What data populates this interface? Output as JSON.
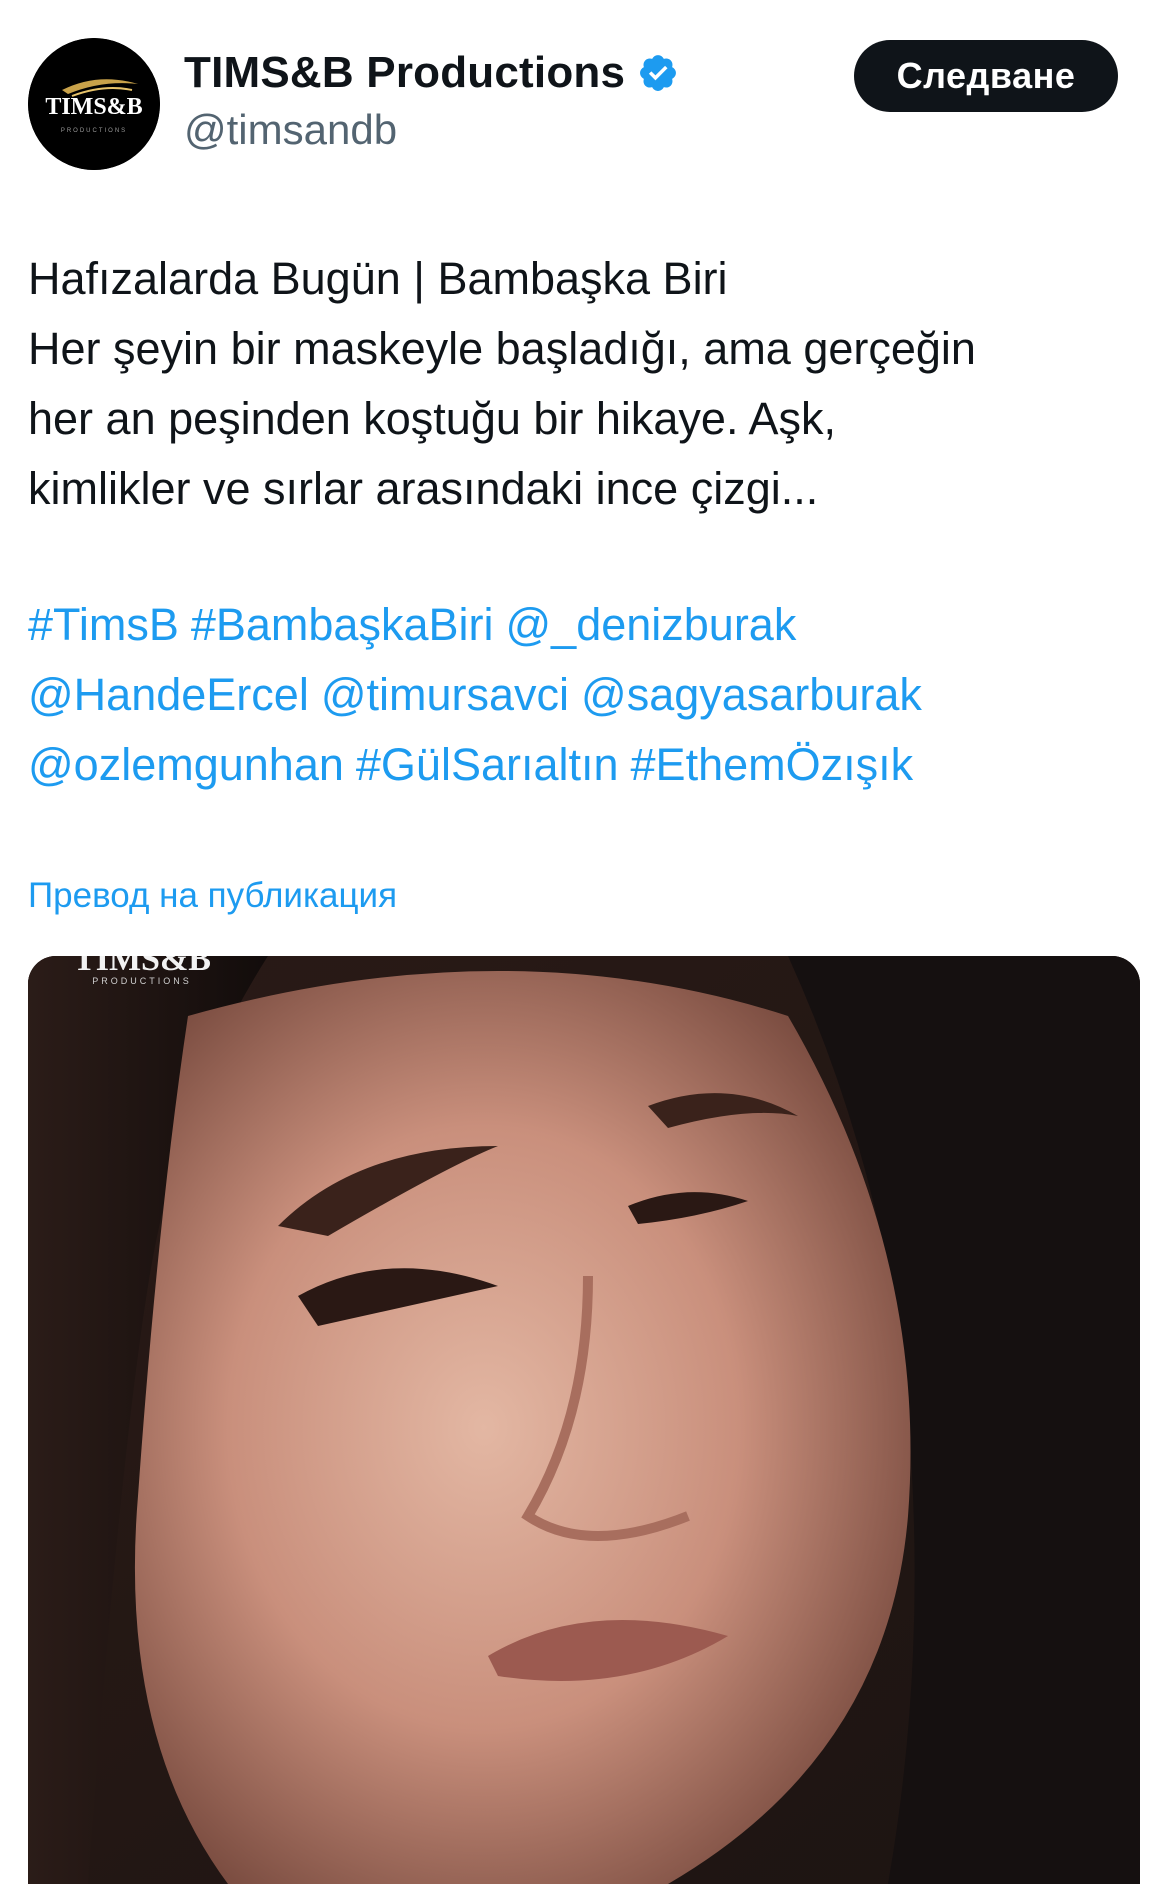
{
  "account": {
    "display_name": "TIMS&B Productions",
    "handle": "@timsandb",
    "avatar_text": "TIMS&B",
    "avatar_subtext": "PRODUCTIONS",
    "verified_icon": "verified-badge-icon",
    "verified_color": "#1d9bf0"
  },
  "actions": {
    "follow_label": "Следване"
  },
  "tweet": {
    "lines": [
      "Hafızalarda Bugün | Bambaşka Biri",
      "Her şeyin bir maskeyle başladığı, ama gerçeğin",
      "her an peşinden koştuğu bir hikaye. Aşk,",
      "kimlikler ve sırlar arasındaki ince çizgi..."
    ],
    "tag_lines": [
      [
        "#TimsB",
        "#BambaşkaBiri",
        "@_denizburak"
      ],
      [
        "@HandeErcel",
        "@timursavci",
        "@sagyasarburak"
      ],
      [
        "@ozlemgunhan",
        "#GülSarıaltın",
        "#EthemÖzışık"
      ]
    ],
    "translate_label": "Превод на публикация"
  },
  "media": {
    "watermark": "TIMS&B",
    "watermark_sub": "PRODUCTIONS"
  },
  "colors": {
    "link": "#1d9bf0",
    "text": "#0f1419",
    "muted": "#536471",
    "button_bg": "#0f1419"
  }
}
